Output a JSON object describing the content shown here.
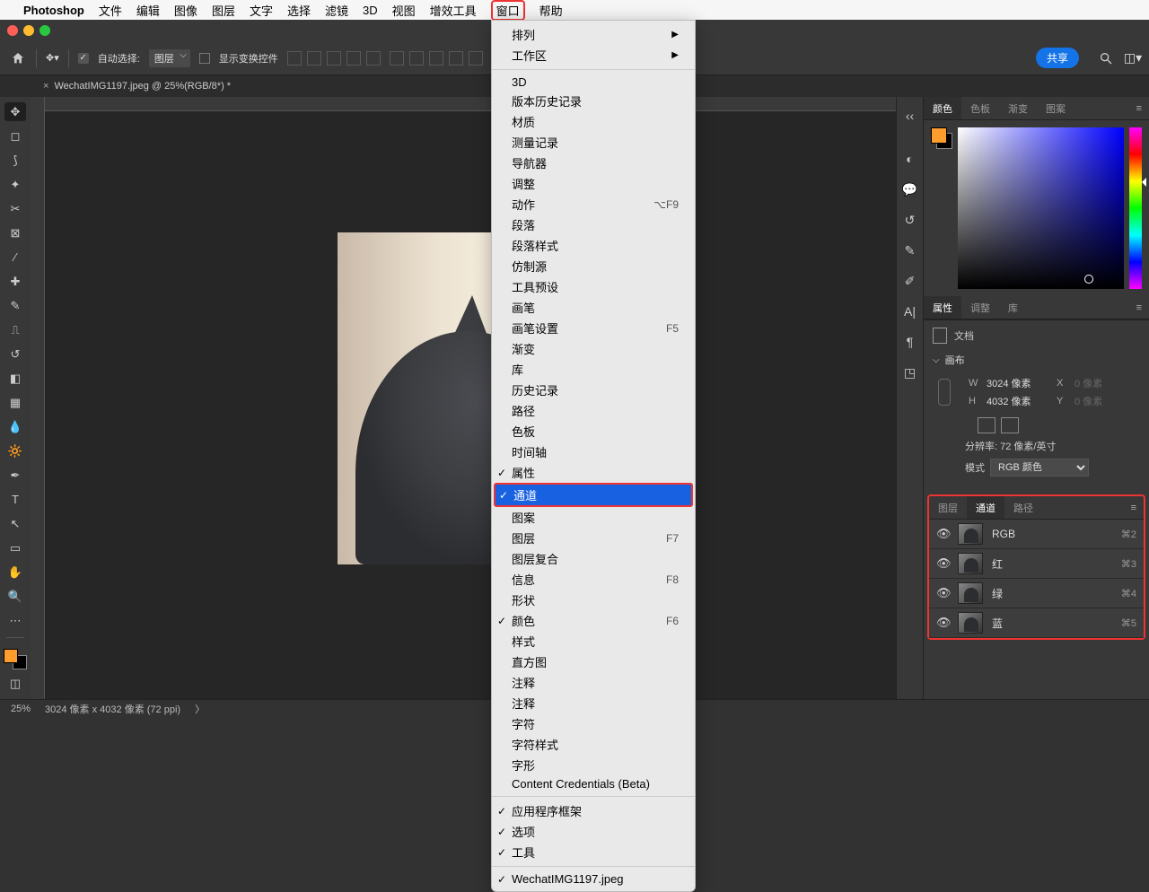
{
  "mac_menu": {
    "app": "Photoshop",
    "items": [
      "文件",
      "编辑",
      "图像",
      "图层",
      "文字",
      "选择",
      "滤镜",
      "3D",
      "视图",
      "增效工具",
      "窗口",
      "帮助"
    ],
    "highlighted_index": 10
  },
  "options_bar": {
    "auto_select_label": "自动选择:",
    "layer_dropdown": "图层",
    "show_transform_label": "显示变换控件",
    "share_label": "共享"
  },
  "doc_tab": {
    "title": "WechatIMG1197.jpeg @ 25%(RGB/8*) *"
  },
  "dropdown": {
    "items": [
      {
        "label": "排列",
        "arrow": true
      },
      {
        "label": "工作区",
        "arrow": true
      },
      {
        "divider": true
      },
      {
        "label": "3D"
      },
      {
        "label": "版本历史记录"
      },
      {
        "label": "材质"
      },
      {
        "label": "测量记录"
      },
      {
        "label": "导航器"
      },
      {
        "label": "调整"
      },
      {
        "label": "动作",
        "shortcut": "⌥F9"
      },
      {
        "label": "段落"
      },
      {
        "label": "段落样式"
      },
      {
        "label": "仿制源"
      },
      {
        "label": "工具预设"
      },
      {
        "label": "画笔"
      },
      {
        "label": "画笔设置",
        "shortcut": "F5"
      },
      {
        "label": "渐变"
      },
      {
        "label": "库"
      },
      {
        "label": "历史记录"
      },
      {
        "label": "路径"
      },
      {
        "label": "色板"
      },
      {
        "label": "时间轴"
      },
      {
        "label": "属性",
        "checked": true
      },
      {
        "label": "通道",
        "checked": true,
        "highlighted": true
      },
      {
        "label": "图案"
      },
      {
        "label": "图层",
        "shortcut": "F7"
      },
      {
        "label": "图层复合"
      },
      {
        "label": "信息",
        "shortcut": "F8"
      },
      {
        "label": "形状"
      },
      {
        "label": "颜色",
        "checked": true,
        "shortcut": "F6"
      },
      {
        "label": "样式"
      },
      {
        "label": "直方图"
      },
      {
        "label": "注释"
      },
      {
        "label": "注释"
      },
      {
        "label": "字符"
      },
      {
        "label": "字符样式"
      },
      {
        "label": "字形"
      },
      {
        "label": "Content Credentials (Beta)"
      },
      {
        "divider": true
      },
      {
        "label": "应用程序框架",
        "checked": true
      },
      {
        "label": "选项",
        "checked": true
      },
      {
        "label": "工具",
        "checked": true
      },
      {
        "divider": true
      },
      {
        "label": "WechatIMG1197.jpeg",
        "checked": true
      }
    ]
  },
  "panels": {
    "color_tabs": [
      "颜色",
      "色板",
      "渐变",
      "图案"
    ],
    "props_tabs": [
      "属性",
      "调整",
      "库"
    ],
    "doc_label": "文档",
    "canvas_label": "画布",
    "w_label": "W",
    "w_value": "3024 像素",
    "x_label": "X",
    "x_ghost": "0 像素",
    "h_label": "H",
    "h_value": "4032 像素",
    "y_label": "Y",
    "y_ghost": "0 像素",
    "res_label": "分辨率: 72 像素/英寸",
    "mode_label": "模式",
    "mode_value": "RGB 颜色",
    "layer_tabs": [
      "图层",
      "通道",
      "路径"
    ],
    "channels": [
      {
        "name": "RGB",
        "shortcut": "⌘2"
      },
      {
        "name": "红",
        "shortcut": "⌘3"
      },
      {
        "name": "绿",
        "shortcut": "⌘4"
      },
      {
        "name": "蓝",
        "shortcut": "⌘5"
      }
    ]
  },
  "status": {
    "zoom": "25%",
    "dims": "3024 像素 x 4032 像素 (72 ppi)"
  }
}
